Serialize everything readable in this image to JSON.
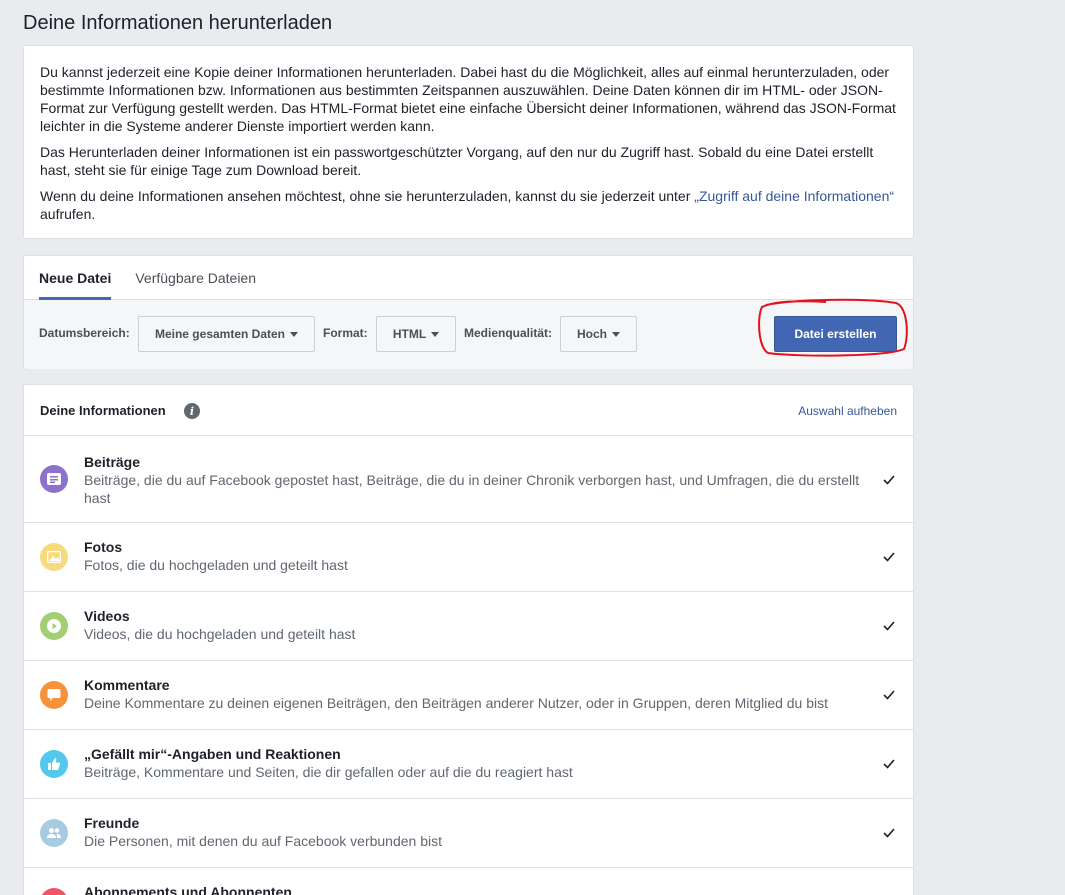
{
  "page_title": "Deine Informationen herunterladen",
  "intro": {
    "p1": "Du kannst jederzeit eine Kopie deiner Informationen herunterladen. Dabei hast du die Möglichkeit, alles auf einmal herunterzuladen, oder bestimmte Informationen bzw. Informationen aus bestimmten Zeitspannen auszuwählen. Deine Daten können dir im HTML- oder JSON-Format zur Verfügung gestellt werden. Das HTML-Format bietet eine einfache Übersicht deiner Informationen, während das JSON-Format leichter in die Systeme anderer Dienste importiert werden kann.",
    "p2": "Das Herunterladen deiner Informationen ist ein passwortgeschützter Vorgang, auf den nur du Zugriff hast. Sobald du eine Datei erstellt hast, steht sie für einige Tage zum Download bereit.",
    "p3_before": "Wenn du deine Informationen ansehen möchtest, ohne sie herunterzuladen, kannst du sie jederzeit unter ",
    "p3_link": "„Zugriff auf deine Informationen“",
    "p3_after": " aufrufen."
  },
  "tabs": [
    {
      "label": "Neue Datei",
      "active": true
    },
    {
      "label": "Verfügbare Dateien",
      "active": false
    }
  ],
  "controls": {
    "date_label": "Datumsbereich:",
    "date_value": "Meine gesamten Daten",
    "format_label": "Format:",
    "format_value": "HTML",
    "quality_label": "Medienqualität:",
    "quality_value": "Hoch",
    "create_button": "Datei erstellen"
  },
  "info": {
    "title": "Deine Informationen",
    "deselect": "Auswahl aufheben",
    "items": [
      {
        "title": "Beiträge",
        "desc": "Beiträge, die du auf Facebook gepostet hast, Beiträge, die du in deiner Chronik verborgen hast, und Umfragen, die du erstellt hast",
        "color": "#8c72cb",
        "icon": "posts-icon",
        "checked": true
      },
      {
        "title": "Fotos",
        "desc": "Fotos, die du hochgeladen und geteilt hast",
        "color": "#f7d97e",
        "icon": "photos-icon",
        "checked": true
      },
      {
        "title": "Videos",
        "desc": "Videos, die du hochgeladen und geteilt hast",
        "color": "#a3ce71",
        "icon": "videos-icon",
        "checked": true
      },
      {
        "title": "Kommentare",
        "desc": "Deine Kommentare zu deinen eigenen Beiträgen, den Beiträgen anderer Nutzer, oder in Gruppen, deren Mitglied du bist",
        "color": "#f7923b",
        "icon": "comments-icon",
        "checked": true
      },
      {
        "title": "„Gefällt mir“-Angaben und Reaktionen",
        "desc": "Beiträge, Kommentare und Seiten, die dir gefallen oder auf die du reagiert hast",
        "color": "#54c7ec",
        "icon": "like-icon",
        "checked": true
      },
      {
        "title": "Freunde",
        "desc": "Die Personen, mit denen du auf Facebook verbunden bist",
        "color": "#a7cce0",
        "icon": "friends-icon",
        "checked": true
      },
      {
        "title": "Abonnements und Abonnenten",
        "desc": "",
        "color": "#f35369",
        "icon": "follow-icon",
        "checked": true
      }
    ]
  },
  "colors": {
    "accent": "#4267b2",
    "link": "#365899",
    "annotation": "#e0141e"
  }
}
